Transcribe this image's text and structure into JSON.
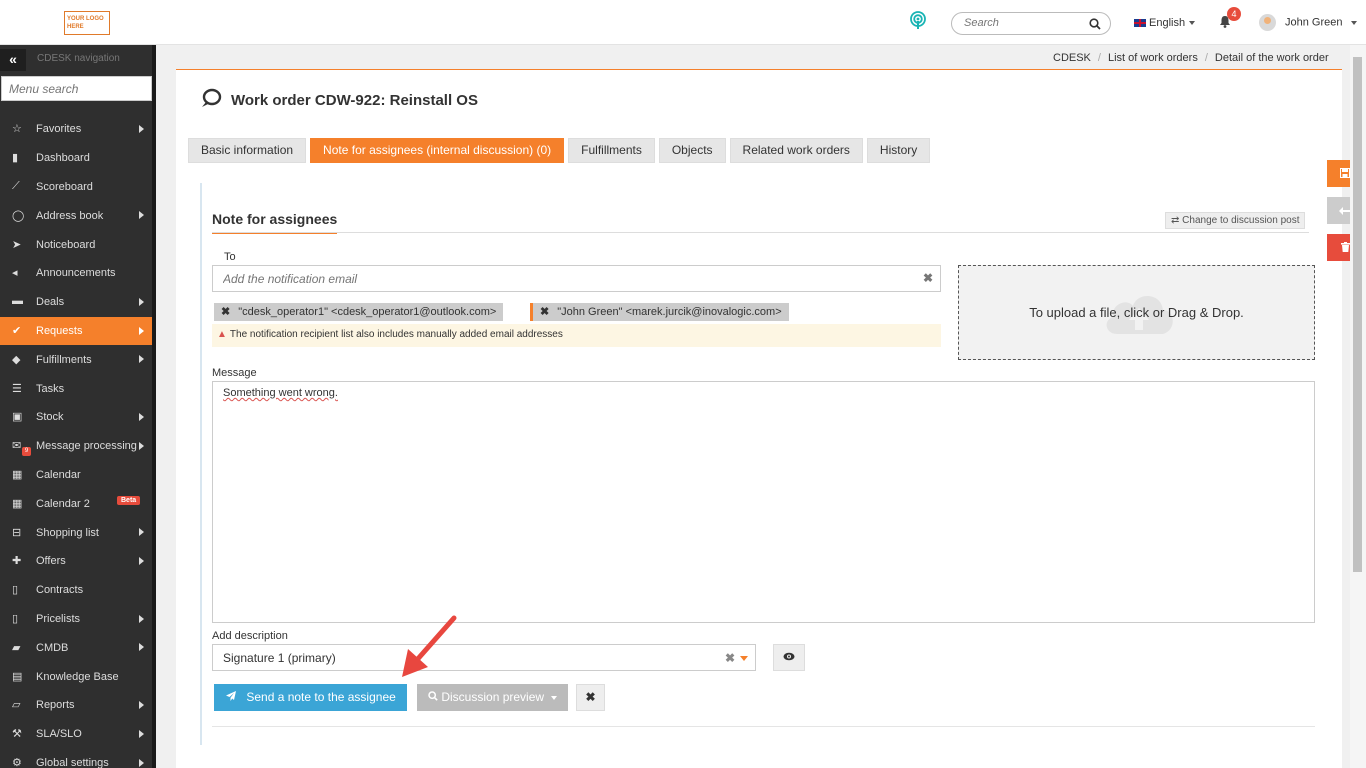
{
  "header": {
    "logo_text": "YOUR LOGO HERE",
    "search_placeholder": "Search",
    "language": "English",
    "notifications_count": "4",
    "user_name": "John Green"
  },
  "sidebar": {
    "title": "CDESK navigation",
    "search_placeholder": "Menu search",
    "items": [
      {
        "label": "Favorites",
        "icon": "star-icon",
        "submenu": true
      },
      {
        "label": "Dashboard",
        "icon": "bar-chart-icon",
        "submenu": false
      },
      {
        "label": "Scoreboard",
        "icon": "line-chart-icon",
        "submenu": false
      },
      {
        "label": "Address book",
        "icon": "user-icon",
        "submenu": true
      },
      {
        "label": "Noticeboard",
        "icon": "paper-plane-icon",
        "submenu": false
      },
      {
        "label": "Announcements",
        "icon": "megaphone-icon",
        "submenu": false
      },
      {
        "label": "Deals",
        "icon": "deals-icon",
        "submenu": true
      },
      {
        "label": "Requests",
        "icon": "check-circle-icon",
        "submenu": true,
        "active": true
      },
      {
        "label": "Fulfillments",
        "icon": "cube-icon",
        "submenu": true
      },
      {
        "label": "Tasks",
        "icon": "tasks-icon",
        "submenu": false
      },
      {
        "label": "Stock",
        "icon": "archive-icon",
        "submenu": true
      },
      {
        "label": "Message processing",
        "icon": "envelope-icon",
        "submenu": true,
        "badge": "9"
      },
      {
        "label": "Calendar",
        "icon": "calendar-icon",
        "submenu": false
      },
      {
        "label": "Calendar 2",
        "icon": "calendar-icon",
        "submenu": false,
        "tag": "Beta"
      },
      {
        "label": "Shopping list",
        "icon": "cart-icon",
        "submenu": true
      },
      {
        "label": "Offers",
        "icon": "gift-icon",
        "submenu": true
      },
      {
        "label": "Contracts",
        "icon": "file-icon",
        "submenu": false
      },
      {
        "label": "Pricelists",
        "icon": "file-icon",
        "submenu": true
      },
      {
        "label": "CMDB",
        "icon": "folder-icon",
        "submenu": true
      },
      {
        "label": "Knowledge Base",
        "icon": "book-icon",
        "submenu": false
      },
      {
        "label": "Reports",
        "icon": "folder-open-icon",
        "submenu": true
      },
      {
        "label": "SLA/SLO",
        "icon": "gavel-icon",
        "submenu": true
      },
      {
        "label": "Global settings",
        "icon": "gears-icon",
        "submenu": true
      }
    ]
  },
  "breadcrumb": [
    "CDESK",
    "List of work orders",
    "Detail of the work order"
  ],
  "page": {
    "title": "Work order CDW-922: Reinstall OS",
    "tabs": [
      {
        "label": "Basic information",
        "active": false
      },
      {
        "label": "Note for assignees (internal discussion) (0)",
        "active": true
      },
      {
        "label": "Fulfillments",
        "active": false
      },
      {
        "label": "Objects",
        "active": false
      },
      {
        "label": "Related work orders",
        "active": false
      },
      {
        "label": "History",
        "active": false
      }
    ]
  },
  "note": {
    "section_title": "Note for assignees",
    "change_button": "Change to discussion post",
    "to_label": "To",
    "to_placeholder": "Add the notification email",
    "recipients": [
      "\"cdesk_operator1\" <cdesk_operator1@outlook.com>",
      "\"John Green\" <marek.jurcik@inovalogic.com>"
    ],
    "warning": "The notification recipient list also includes manually added email addresses",
    "upload_text": "To upload a file, click or Drag & Drop.",
    "message_label": "Message",
    "message_value": "Something went wrong.",
    "description_label": "Add description",
    "description_value": "Signature 1 (primary)",
    "send_button": "Send a note to the assignee",
    "preview_button": "Discussion preview"
  },
  "colors": {
    "accent": "#f5802b",
    "send": "#3ba5d6",
    "danger": "#e74c3c",
    "sidebar_bg": "#2f2f2f"
  }
}
